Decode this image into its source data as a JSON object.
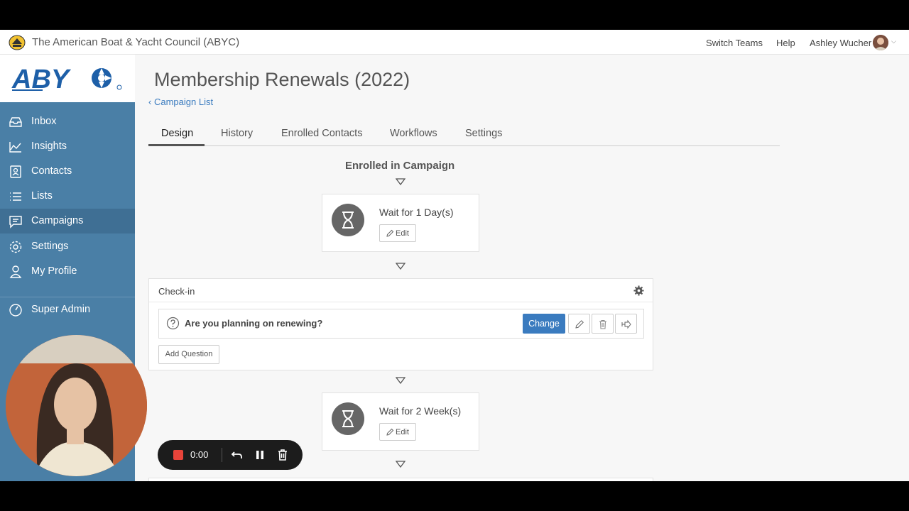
{
  "app": {
    "org_name": "The American Boat & Yacht Council (ABYC)",
    "brand_logo_text": "ABYC",
    "accent": "#3a7bbf",
    "sidebar_color": "#4a7fa6"
  },
  "header_nav": {
    "switch_teams": "Switch Teams",
    "help": "Help",
    "user_name": "Ashley Wucher"
  },
  "sidebar": {
    "items": [
      {
        "label": "Inbox",
        "icon": "inbox-icon"
      },
      {
        "label": "Insights",
        "icon": "chart-icon"
      },
      {
        "label": "Contacts",
        "icon": "contacts-icon"
      },
      {
        "label": "Lists",
        "icon": "list-icon"
      },
      {
        "label": "Campaigns",
        "icon": "chat-icon",
        "active": true
      },
      {
        "label": "Settings",
        "icon": "gear-icon"
      },
      {
        "label": "My Profile",
        "icon": "user-icon"
      }
    ],
    "super_admin": "Super Admin"
  },
  "page": {
    "title": "Membership Renewals (2022)",
    "back_link": "Campaign List",
    "back_chevron": "‹",
    "tabs": [
      "Design",
      "History",
      "Enrolled Contacts",
      "Workflows",
      "Settings"
    ],
    "active_tab": "Design"
  },
  "flow": {
    "heading": "Enrolled in Campaign",
    "wait1": "Wait for 1 Day(s)",
    "wait2": "Wait for 2 Week(s)",
    "edit_label": "Edit",
    "checkin": {
      "title": "Check-in",
      "question": "Are you planning on renewing?",
      "change_label": "Change",
      "add_question_label": "Add Question"
    }
  },
  "recorder": {
    "time": "0:00"
  }
}
